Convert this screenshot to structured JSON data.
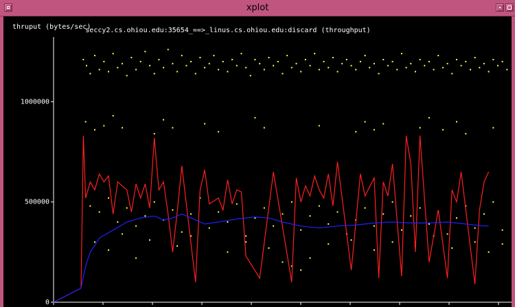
{
  "window": {
    "title": "xplot"
  },
  "plot": {
    "ylabel": "thruput (bytes/sec)",
    "title": "seccy2.cs.ohiou.edu:35654_==>_linus.cs.ohiou.edu:discard (throughput)"
  },
  "colors": {
    "frame": "#c0557f",
    "background": "#000000",
    "points": "#ffff55",
    "instant": "#ff2020",
    "average": "#2020ff",
    "axis": "#ffffff"
  },
  "chart_data": {
    "type": "scatter",
    "title": "seccy2.cs.ohiou.edu:35654_==>_linus.cs.ohiou.edu:discard (throughput)",
    "ylabel": "thruput (bytes/sec)",
    "xlabel": "",
    "ylim": [
      0,
      1350000
    ],
    "xlim": [
      0,
      100
    ],
    "y_ticks": [
      {
        "value": 0,
        "label": "0"
      },
      {
        "value": 500000,
        "label": "500000"
      },
      {
        "value": 1000000,
        "label": "1000000"
      }
    ],
    "series": [
      {
        "kind": "points",
        "values": [
          [
            6.5,
            1210000
          ],
          [
            7.2,
            1180000
          ],
          [
            8,
            1140000
          ],
          [
            9,
            1230000
          ],
          [
            10,
            1160000
          ],
          [
            11,
            1200000
          ],
          [
            12,
            1150000
          ],
          [
            13,
            1240000
          ],
          [
            14,
            1170000
          ],
          [
            15,
            1190000
          ],
          [
            16,
            1130000
          ],
          [
            17,
            1220000
          ],
          [
            18,
            1160000
          ],
          [
            19,
            1200000
          ],
          [
            20,
            1250000
          ],
          [
            21,
            1180000
          ],
          [
            22,
            1140000
          ],
          [
            23,
            1210000
          ],
          [
            24,
            1170000
          ],
          [
            25,
            1260000
          ],
          [
            26,
            1190000
          ],
          [
            27,
            1150000
          ],
          [
            28,
            1230000
          ],
          [
            29,
            1180000
          ],
          [
            30,
            1200000
          ],
          [
            31,
            1140000
          ],
          [
            32,
            1220000
          ],
          [
            33,
            1170000
          ],
          [
            34,
            1190000
          ],
          [
            35,
            1230000
          ],
          [
            36,
            1160000
          ],
          [
            37,
            1200000
          ],
          [
            38,
            1150000
          ],
          [
            39,
            1210000
          ],
          [
            40,
            1180000
          ],
          [
            41,
            1240000
          ],
          [
            42,
            1170000
          ],
          [
            43,
            1130000
          ],
          [
            44,
            1210000
          ],
          [
            45,
            1190000
          ],
          [
            46,
            1160000
          ],
          [
            47,
            1220000
          ],
          [
            48,
            1180000
          ],
          [
            49,
            1200000
          ],
          [
            50,
            1140000
          ],
          [
            51,
            1230000
          ],
          [
            52,
            1170000
          ],
          [
            53,
            1190000
          ],
          [
            54,
            1150000
          ],
          [
            55,
            1210000
          ],
          [
            56,
            1180000
          ],
          [
            57,
            1240000
          ],
          [
            58,
            1160000
          ],
          [
            59,
            1200000
          ],
          [
            60,
            1170000
          ],
          [
            61,
            1220000
          ],
          [
            62,
            1150000
          ],
          [
            63,
            1190000
          ],
          [
            64,
            1210000
          ],
          [
            65,
            1180000
          ],
          [
            66,
            1160000
          ],
          [
            67,
            1200000
          ],
          [
            68,
            1230000
          ],
          [
            69,
            1170000
          ],
          [
            70,
            1190000
          ],
          [
            71,
            1140000
          ],
          [
            72,
            1210000
          ],
          [
            73,
            1180000
          ],
          [
            74,
            1200000
          ],
          [
            75,
            1160000
          ],
          [
            76,
            1240000
          ],
          [
            77,
            1170000
          ],
          [
            78,
            1190000
          ],
          [
            79,
            1150000
          ],
          [
            80,
            1210000
          ],
          [
            81,
            1180000
          ],
          [
            82,
            1200000
          ],
          [
            83,
            1160000
          ],
          [
            84,
            1230000
          ],
          [
            85,
            1170000
          ],
          [
            86,
            1190000
          ],
          [
            87,
            1140000
          ],
          [
            88,
            1210000
          ],
          [
            89,
            1180000
          ],
          [
            90,
            1200000
          ],
          [
            91,
            1160000
          ],
          [
            92,
            1220000
          ],
          [
            93,
            1170000
          ],
          [
            94,
            1190000
          ],
          [
            95,
            1150000
          ],
          [
            96,
            1210000
          ],
          [
            97,
            1180000
          ],
          [
            98,
            1200000
          ],
          [
            99,
            1160000
          ],
          [
            7,
            900000
          ],
          [
            9,
            860000
          ],
          [
            11,
            880000
          ],
          [
            13,
            930000
          ],
          [
            15,
            870000
          ],
          [
            22,
            840000
          ],
          [
            24,
            910000
          ],
          [
            26,
            870000
          ],
          [
            33,
            890000
          ],
          [
            36,
            850000
          ],
          [
            44,
            920000
          ],
          [
            46,
            870000
          ],
          [
            58,
            880000
          ],
          [
            66,
            850000
          ],
          [
            68,
            900000
          ],
          [
            70,
            860000
          ],
          [
            72,
            890000
          ],
          [
            80,
            870000
          ],
          [
            82,
            920000
          ],
          [
            85,
            860000
          ],
          [
            88,
            900000
          ],
          [
            90,
            840000
          ],
          [
            96,
            870000
          ],
          [
            8,
            480000
          ],
          [
            10,
            450000
          ],
          [
            12,
            520000
          ],
          [
            14,
            400000
          ],
          [
            16,
            470000
          ],
          [
            18,
            380000
          ],
          [
            20,
            430000
          ],
          [
            22,
            500000
          ],
          [
            24,
            410000
          ],
          [
            26,
            460000
          ],
          [
            28,
            350000
          ],
          [
            30,
            440000
          ],
          [
            32,
            520000
          ],
          [
            34,
            370000
          ],
          [
            36,
            450000
          ],
          [
            38,
            400000
          ],
          [
            40,
            490000
          ],
          [
            42,
            330000
          ],
          [
            44,
            420000
          ],
          [
            46,
            470000
          ],
          [
            48,
            380000
          ],
          [
            50,
            440000
          ],
          [
            52,
            500000
          ],
          [
            54,
            360000
          ],
          [
            56,
            430000
          ],
          [
            58,
            480000
          ],
          [
            60,
            390000
          ],
          [
            62,
            450000
          ],
          [
            64,
            340000
          ],
          [
            66,
            410000
          ],
          [
            68,
            470000
          ],
          [
            70,
            380000
          ],
          [
            72,
            440000
          ],
          [
            74,
            500000
          ],
          [
            76,
            360000
          ],
          [
            78,
            430000
          ],
          [
            80,
            470000
          ],
          [
            82,
            390000
          ],
          [
            84,
            450000
          ],
          [
            86,
            340000
          ],
          [
            88,
            420000
          ],
          [
            90,
            480000
          ],
          [
            92,
            370000
          ],
          [
            94,
            440000
          ],
          [
            96,
            500000
          ],
          [
            98,
            360000
          ],
          [
            9,
            300000
          ],
          [
            12,
            260000
          ],
          [
            15,
            340000
          ],
          [
            18,
            220000
          ],
          [
            21,
            310000
          ],
          [
            27,
            280000
          ],
          [
            30,
            330000
          ],
          [
            38,
            250000
          ],
          [
            42,
            300000
          ],
          [
            47,
            270000
          ],
          [
            50,
            200000
          ],
          [
            52,
            180000
          ],
          [
            54,
            160000
          ],
          [
            56,
            220000
          ],
          [
            60,
            290000
          ],
          [
            65,
            310000
          ],
          [
            70,
            260000
          ],
          [
            74,
            300000
          ],
          [
            79,
            280000
          ],
          [
            83,
            330000
          ],
          [
            87,
            270000
          ],
          [
            92,
            300000
          ],
          [
            95,
            250000
          ],
          [
            98,
            290000
          ]
        ]
      },
      {
        "kind": "instantaneous",
        "values": [
          [
            0,
            0
          ],
          [
            6,
            70000
          ],
          [
            6.5,
            830000
          ],
          [
            7,
            520000
          ],
          [
            8,
            600000
          ],
          [
            9,
            560000
          ],
          [
            10,
            640000
          ],
          [
            11,
            600000
          ],
          [
            12,
            630000
          ],
          [
            13,
            440000
          ],
          [
            14,
            600000
          ],
          [
            15,
            580000
          ],
          [
            16,
            560000
          ],
          [
            17,
            450000
          ],
          [
            18,
            590000
          ],
          [
            19,
            520000
          ],
          [
            20,
            590000
          ],
          [
            21,
            470000
          ],
          [
            22,
            820000
          ],
          [
            23,
            560000
          ],
          [
            24,
            600000
          ],
          [
            25,
            440000
          ],
          [
            26,
            250000
          ],
          [
            27,
            450000
          ],
          [
            28,
            680000
          ],
          [
            31,
            100000
          ],
          [
            32,
            560000
          ],
          [
            33,
            660000
          ],
          [
            34,
            490000
          ],
          [
            36,
            520000
          ],
          [
            37,
            460000
          ],
          [
            38,
            610000
          ],
          [
            39,
            490000
          ],
          [
            40,
            560000
          ],
          [
            41,
            550000
          ],
          [
            42,
            230000
          ],
          [
            45,
            120000
          ],
          [
            48,
            650000
          ],
          [
            52,
            100000
          ],
          [
            53,
            620000
          ],
          [
            54,
            500000
          ],
          [
            55,
            580000
          ],
          [
            56,
            530000
          ],
          [
            57,
            630000
          ],
          [
            58,
            560000
          ],
          [
            59,
            520000
          ],
          [
            60,
            640000
          ],
          [
            61,
            480000
          ],
          [
            62,
            700000
          ],
          [
            65,
            160000
          ],
          [
            67,
            640000
          ],
          [
            68,
            530000
          ],
          [
            70,
            620000
          ],
          [
            71,
            120000
          ],
          [
            72,
            600000
          ],
          [
            73,
            530000
          ],
          [
            74,
            690000
          ],
          [
            76,
            130000
          ],
          [
            77,
            830000
          ],
          [
            78,
            690000
          ],
          [
            79,
            250000
          ],
          [
            80,
            830000
          ],
          [
            82,
            200000
          ],
          [
            84,
            460000
          ],
          [
            86,
            120000
          ],
          [
            87,
            560000
          ],
          [
            88,
            500000
          ],
          [
            89,
            650000
          ],
          [
            92,
            90000
          ],
          [
            93,
            460000
          ],
          [
            94,
            600000
          ],
          [
            95,
            650000
          ]
        ]
      },
      {
        "kind": "average",
        "values": [
          [
            0,
            0
          ],
          [
            6,
            70000
          ],
          [
            7,
            180000
          ],
          [
            8,
            250000
          ],
          [
            10,
            320000
          ],
          [
            13,
            360000
          ],
          [
            16,
            400000
          ],
          [
            19,
            420000
          ],
          [
            22,
            430000
          ],
          [
            24,
            410000
          ],
          [
            26,
            420000
          ],
          [
            28,
            440000
          ],
          [
            30,
            420000
          ],
          [
            33,
            390000
          ],
          [
            36,
            400000
          ],
          [
            40,
            415000
          ],
          [
            44,
            425000
          ],
          [
            47,
            420000
          ],
          [
            50,
            400000
          ],
          [
            54,
            380000
          ],
          [
            58,
            370000
          ],
          [
            62,
            380000
          ],
          [
            66,
            385000
          ],
          [
            70,
            395000
          ],
          [
            74,
            400000
          ],
          [
            78,
            395000
          ],
          [
            82,
            395000
          ],
          [
            86,
            400000
          ],
          [
            90,
            390000
          ],
          [
            94,
            380000
          ],
          [
            95,
            380000
          ]
        ]
      }
    ]
  }
}
